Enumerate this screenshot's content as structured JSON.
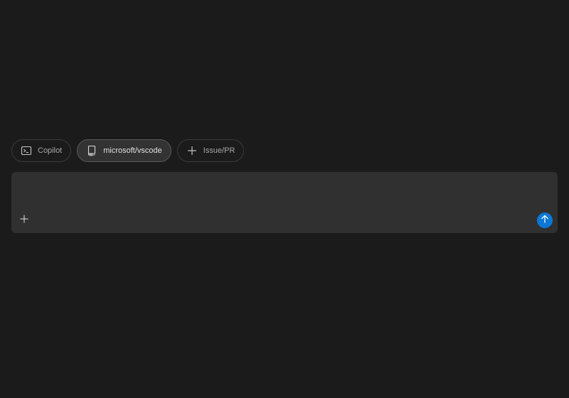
{
  "chips": [
    {
      "label": "Copilot",
      "icon": "terminal-icon",
      "active": false
    },
    {
      "label": "microsoft/vscode",
      "icon": "repo-icon",
      "active": true
    },
    {
      "label": "Issue/PR",
      "icon": "plus-icon",
      "active": false
    }
  ],
  "input": {
    "value": "",
    "placeholder": ""
  },
  "actions": {
    "add_icon": "plus-icon",
    "send_icon": "arrow-up-icon"
  },
  "colors": {
    "background": "#1b1b1b",
    "input_background": "#303030",
    "send_button": "#0a78d4"
  }
}
